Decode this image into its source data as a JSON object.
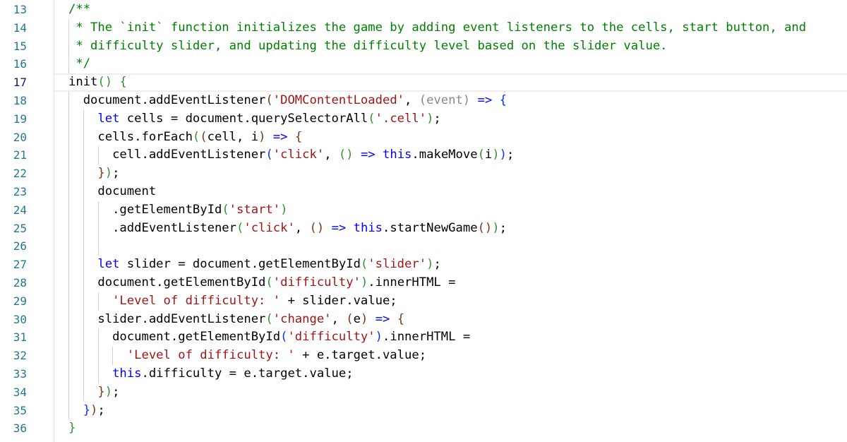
{
  "editor": {
    "colors": {
      "comment": "#008000",
      "keyword": "#0000ff",
      "string": "#a31515",
      "bracket_1": "#0431fa",
      "bracket_2": "#319331",
      "bracket_3": "#7b3814",
      "line_number": "#237893"
    },
    "active_line": 17,
    "lines": [
      {
        "n": "13",
        "tokens": [
          [
            "c",
            "/**"
          ]
        ]
      },
      {
        "n": "14",
        "tokens": [
          [
            "c",
            " * The `init` function initializes the game by adding event listeners to the cells, start button, and"
          ]
        ]
      },
      {
        "n": "15",
        "tokens": [
          [
            "c",
            " * difficulty slider, and updating the difficulty level based on the slider value."
          ]
        ]
      },
      {
        "n": "16",
        "tokens": [
          [
            "c",
            " */"
          ]
        ]
      },
      {
        "n": "17",
        "tokens": [
          [
            "t",
            "init"
          ],
          [
            "g",
            "()"
          ],
          [
            "t",
            " "
          ],
          [
            "g",
            "{"
          ]
        ]
      },
      {
        "n": "18",
        "tokens": [
          [
            "t",
            "  document.addEventListener"
          ],
          [
            "r",
            "("
          ],
          [
            "s",
            "'DOMContentLoaded'"
          ],
          [
            "t",
            ", "
          ],
          [
            "p",
            "(event)"
          ],
          [
            "t",
            " "
          ],
          [
            "k",
            "=>"
          ],
          [
            "t",
            " "
          ],
          [
            "b",
            "{"
          ]
        ]
      },
      {
        "n": "19",
        "tokens": [
          [
            "k",
            "    let"
          ],
          [
            "t",
            " cells = document.querySelectorAll"
          ],
          [
            "g",
            "("
          ],
          [
            "s",
            "'.cell'"
          ],
          [
            "g",
            ")"
          ],
          [
            "t",
            ";"
          ]
        ]
      },
      {
        "n": "20",
        "tokens": [
          [
            "t",
            "    cells.forEach"
          ],
          [
            "g",
            "("
          ],
          [
            "r",
            "("
          ],
          [
            "t",
            "cell, i"
          ],
          [
            "r",
            ")"
          ],
          [
            "t",
            " "
          ],
          [
            "k",
            "=>"
          ],
          [
            "t",
            " "
          ],
          [
            "r",
            "{"
          ]
        ]
      },
      {
        "n": "21",
        "tokens": [
          [
            "t",
            "      cell.addEventListener"
          ],
          [
            "b",
            "("
          ],
          [
            "s",
            "'click'"
          ],
          [
            "t",
            ", "
          ],
          [
            "g",
            "()"
          ],
          [
            "t",
            " "
          ],
          [
            "k",
            "=>"
          ],
          [
            "t",
            " "
          ],
          [
            "k",
            "this"
          ],
          [
            "t",
            ".makeMove"
          ],
          [
            "g",
            "("
          ],
          [
            "t",
            "i"
          ],
          [
            "g",
            ")"
          ],
          [
            "b",
            ")"
          ],
          [
            "t",
            ";"
          ]
        ]
      },
      {
        "n": "22",
        "tokens": [
          [
            "r",
            "    }"
          ],
          [
            "g",
            ")"
          ],
          [
            "t",
            ";"
          ]
        ]
      },
      {
        "n": "23",
        "tokens": [
          [
            "t",
            "    document"
          ]
        ]
      },
      {
        "n": "24",
        "tokens": [
          [
            "t",
            "      .getElementById"
          ],
          [
            "g",
            "("
          ],
          [
            "s",
            "'start'"
          ],
          [
            "g",
            ")"
          ]
        ]
      },
      {
        "n": "25",
        "tokens": [
          [
            "t",
            "      .addEventListener"
          ],
          [
            "g",
            "("
          ],
          [
            "s",
            "'click'"
          ],
          [
            "t",
            ", "
          ],
          [
            "r",
            "()"
          ],
          [
            "t",
            " "
          ],
          [
            "k",
            "=>"
          ],
          [
            "t",
            " "
          ],
          [
            "k",
            "this"
          ],
          [
            "t",
            ".startNewGame"
          ],
          [
            "r",
            "()"
          ],
          [
            "g",
            ")"
          ],
          [
            "t",
            ";"
          ]
        ]
      },
      {
        "n": "26",
        "tokens": [
          [
            "t",
            "    "
          ]
        ]
      },
      {
        "n": "27",
        "tokens": [
          [
            "k",
            "    let"
          ],
          [
            "t",
            " slider = document.getElementById"
          ],
          [
            "g",
            "("
          ],
          [
            "s",
            "'slider'"
          ],
          [
            "g",
            ")"
          ],
          [
            "t",
            ";"
          ]
        ]
      },
      {
        "n": "28",
        "tokens": [
          [
            "t",
            "    document.getElementById"
          ],
          [
            "g",
            "("
          ],
          [
            "s",
            "'difficulty'"
          ],
          [
            "g",
            ")"
          ],
          [
            "t",
            ".innerHTML ="
          ]
        ]
      },
      {
        "n": "29",
        "tokens": [
          [
            "s",
            "      'Level of difficulty: '"
          ],
          [
            "t",
            " + slider.value;"
          ]
        ]
      },
      {
        "n": "30",
        "tokens": [
          [
            "t",
            "    slider.addEventListener"
          ],
          [
            "g",
            "("
          ],
          [
            "s",
            "'change'"
          ],
          [
            "t",
            ", "
          ],
          [
            "r",
            "("
          ],
          [
            "t",
            "e"
          ],
          [
            "r",
            ")"
          ],
          [
            "t",
            " "
          ],
          [
            "k",
            "=>"
          ],
          [
            "t",
            " "
          ],
          [
            "r",
            "{"
          ]
        ]
      },
      {
        "n": "31",
        "tokens": [
          [
            "t",
            "      document.getElementById"
          ],
          [
            "b",
            "("
          ],
          [
            "s",
            "'difficulty'"
          ],
          [
            "b",
            ")"
          ],
          [
            "t",
            ".innerHTML ="
          ]
        ]
      },
      {
        "n": "32",
        "tokens": [
          [
            "s",
            "        'Level of difficulty: '"
          ],
          [
            "t",
            " + e.target.value;"
          ]
        ]
      },
      {
        "n": "33",
        "tokens": [
          [
            "k",
            "      this"
          ],
          [
            "t",
            ".difficulty = e.target.value;"
          ]
        ]
      },
      {
        "n": "34",
        "tokens": [
          [
            "r",
            "    }"
          ],
          [
            "g",
            ")"
          ],
          [
            "t",
            ";"
          ]
        ]
      },
      {
        "n": "35",
        "tokens": [
          [
            "b",
            "  }"
          ],
          [
            "r",
            ")"
          ],
          [
            "t",
            ";"
          ]
        ]
      },
      {
        "n": "36",
        "tokens": [
          [
            "g",
            "}"
          ]
        ]
      }
    ]
  }
}
